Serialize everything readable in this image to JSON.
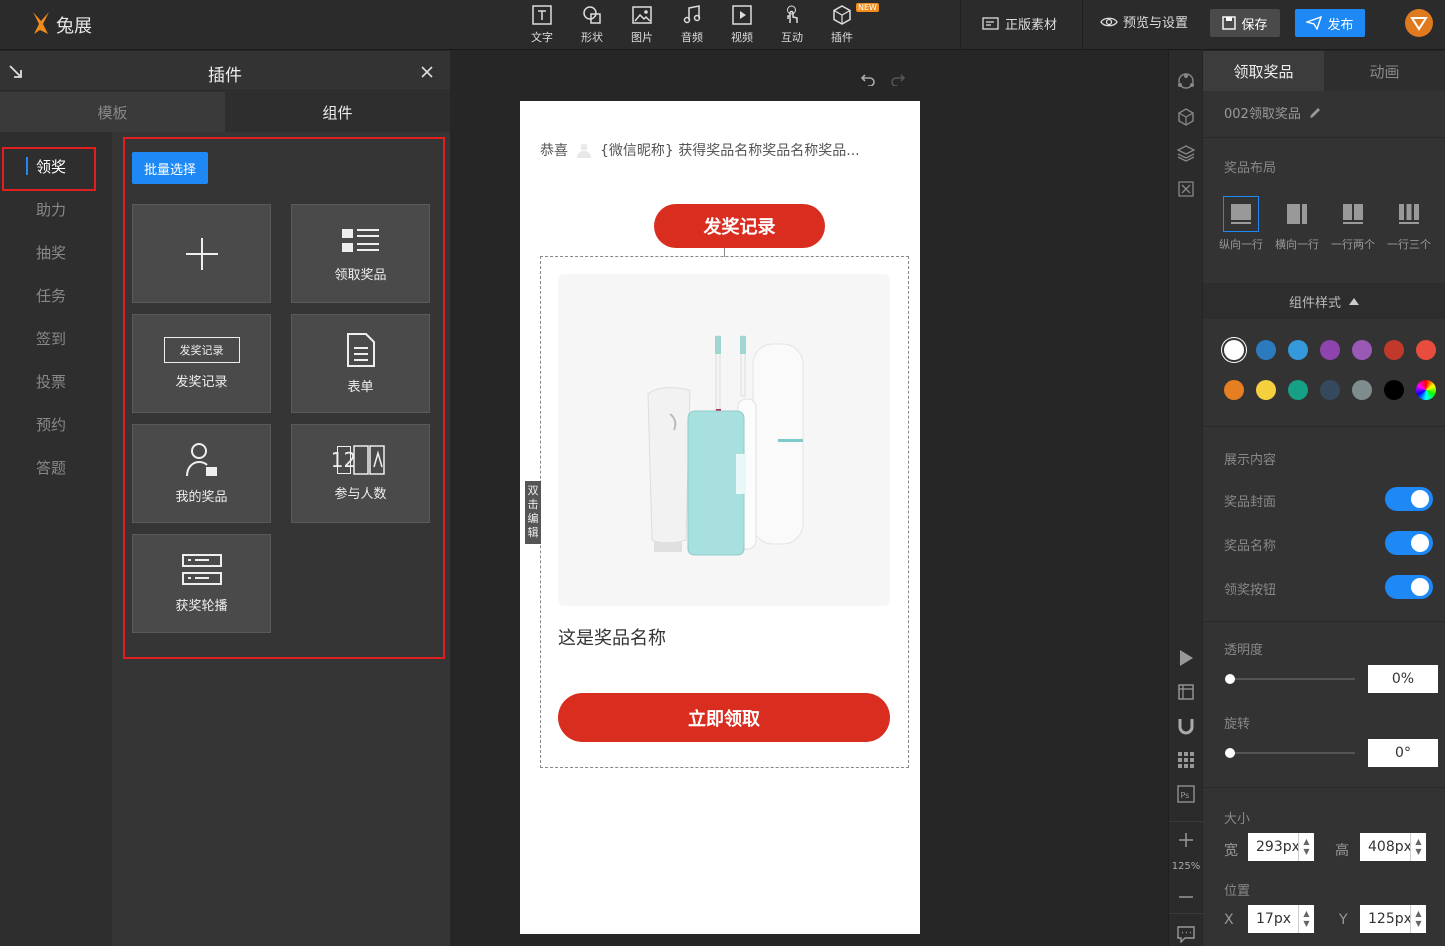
{
  "app": {
    "logo_text": "兔展"
  },
  "toolbar": {
    "tools": [
      {
        "label": "文字",
        "icon": "text-icon"
      },
      {
        "label": "形状",
        "icon": "shape-icon"
      },
      {
        "label": "图片",
        "icon": "image-icon"
      },
      {
        "label": "音频",
        "icon": "music-icon"
      },
      {
        "label": "视频",
        "icon": "video-icon"
      },
      {
        "label": "互动",
        "icon": "hand-icon"
      },
      {
        "label": "插件",
        "icon": "plugin-icon",
        "badge": "NEW"
      }
    ],
    "assets_label": "正版素材",
    "preview_label": "预览与设置",
    "save_label": "保存",
    "publish_label": "发布"
  },
  "left_panel": {
    "title": "插件",
    "tabs": [
      "模板",
      "组件"
    ],
    "active_tab": "组件",
    "categories": [
      "领奖",
      "助力",
      "抽奖",
      "任务",
      "签到",
      "投票",
      "预约",
      "答题"
    ],
    "selected_category": "领奖",
    "batch_select_label": "批量选择",
    "components": [
      {
        "label": "",
        "icon": "plus-icon"
      },
      {
        "label": "领取奖品",
        "icon": "gift-list-icon"
      },
      {
        "label": "发奖记录",
        "icon": "record-box-icon",
        "inner_text": "发奖记录"
      },
      {
        "label": "表单",
        "icon": "form-icon"
      },
      {
        "label": "我的奖品",
        "icon": "user-gift-icon"
      },
      {
        "label": "参与人数",
        "icon": "counter-icon",
        "inner_text": "12"
      },
      {
        "label": "获奖轮播",
        "icon": "carousel-icon"
      }
    ]
  },
  "canvas": {
    "marquee_prefix": "恭喜",
    "marquee_text": "{微信昵称} 获得奖品名称奖品名称奖品...",
    "record_button": "发奖记录",
    "prize_name": "这是奖品名称",
    "claim_button": "立即领取",
    "double_click_tip": "双击编辑"
  },
  "right_strip": {
    "zoom": "125%"
  },
  "right_panel": {
    "tabs": [
      "领取奖品",
      "动画"
    ],
    "active_tab": "领取奖品",
    "component_name": "002领取奖品",
    "layout_title": "奖品布局",
    "layouts": [
      "纵向一行",
      "横向一行",
      "一行两个",
      "一行三个"
    ],
    "selected_layout": "纵向一行",
    "style_title": "组件样式",
    "colors": [
      "#ffffff",
      "#2c7bbf",
      "#3498db",
      "#8e44ad",
      "#9b59b6",
      "#c0392b",
      "#e74c3c",
      "#e67e22",
      "#f4d03f",
      "#16a085",
      "#34495e",
      "#7f8c8d",
      "#000000",
      "rainbow"
    ],
    "display_title": "展示内容",
    "toggles": [
      {
        "label": "奖品封面",
        "on": true
      },
      {
        "label": "奖品名称",
        "on": true
      },
      {
        "label": "领奖按钮",
        "on": true
      }
    ],
    "opacity_label": "透明度",
    "opacity_value": "0%",
    "rotate_label": "旋转",
    "rotate_value": "0°",
    "size_label": "大小",
    "width_label": "宽",
    "width_value": "293px",
    "height_label": "高",
    "height_value": "408px",
    "position_label": "位置",
    "x_label": "X",
    "x_value": "17px",
    "y_label": "Y",
    "y_value": "125px"
  }
}
